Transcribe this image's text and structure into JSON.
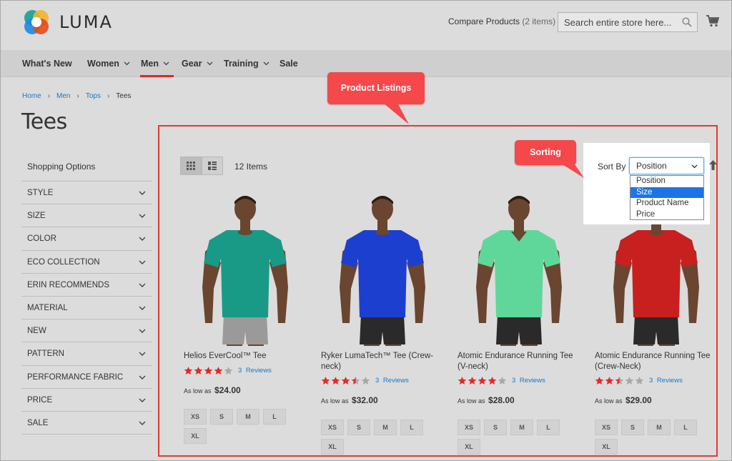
{
  "header": {
    "logo_text": "LUMA",
    "compare_label": "Compare Products",
    "compare_count": "(2 items)",
    "search_placeholder": "Search entire store here..."
  },
  "nav": {
    "items": [
      {
        "label": "What's New",
        "has_menu": false
      },
      {
        "label": "Women",
        "has_menu": true
      },
      {
        "label": "Men",
        "has_menu": true,
        "active": true
      },
      {
        "label": "Gear",
        "has_menu": true
      },
      {
        "label": "Training",
        "has_menu": true
      },
      {
        "label": "Sale",
        "has_menu": false
      }
    ]
  },
  "breadcrumb": [
    "Home",
    "Men",
    "Tops",
    "Tees"
  ],
  "page_title": "Tees",
  "sidebar": {
    "title": "Shopping Options",
    "filters": [
      "STYLE",
      "SIZE",
      "COLOR",
      "ECO COLLECTION",
      "ERIN RECOMMENDS",
      "MATERIAL",
      "NEW",
      "PATTERN",
      "PERFORMANCE FABRIC",
      "PRICE",
      "SALE"
    ]
  },
  "toolbar": {
    "items_count": "12 Items",
    "sort_label": "Sort By",
    "sort_value": "Position",
    "sort_options": [
      "Position",
      "Size",
      "Product Name",
      "Price"
    ],
    "sort_highlighted": "Size"
  },
  "callouts": {
    "product_listings": "Product Listings",
    "sorting": "Sorting"
  },
  "colors": {
    "accent_red": "#e22626",
    "callout": "#f4484b",
    "link": "#1979c3",
    "star": "#e02b27",
    "star_empty": "#a8a8a8"
  },
  "products": [
    {
      "name": "Helios EverCool™ Tee",
      "rating": 4,
      "reviews": "3  Reviews",
      "price_prefix": "As low as",
      "price": "$24.00",
      "sizes": [
        "XS",
        "S",
        "M",
        "L",
        "XL"
      ],
      "shirt_color": "#189a86",
      "shorts_color": "#9a9a9a"
    },
    {
      "name": "Ryker LumaTech™ Tee (Crew-neck)",
      "rating": 3.5,
      "reviews": "3  Reviews",
      "price_prefix": "As low as",
      "price": "$32.00",
      "sizes": [
        "XS",
        "S",
        "M",
        "L",
        "XL"
      ],
      "shirt_color": "#1d3fd0",
      "shorts_color": "#2a2a2a"
    },
    {
      "name": "Atomic Endurance Running Tee (V-neck)",
      "rating": 4,
      "reviews": "3  Reviews",
      "price_prefix": "As low as",
      "price": "$28.00",
      "sizes": [
        "XS",
        "S",
        "M",
        "L",
        "XL"
      ],
      "shirt_color": "#5fd79a",
      "shorts_color": "#2a2a2a"
    },
    {
      "name": "Atomic Endurance Running Tee (Crew-Neck)",
      "rating": 2.5,
      "reviews": "3  Reviews",
      "price_prefix": "As low as",
      "price": "$29.00",
      "sizes": [
        "XS",
        "S",
        "M",
        "L",
        "XL"
      ],
      "shirt_color": "#c8201f",
      "shorts_color": "#2a2a2a"
    }
  ]
}
